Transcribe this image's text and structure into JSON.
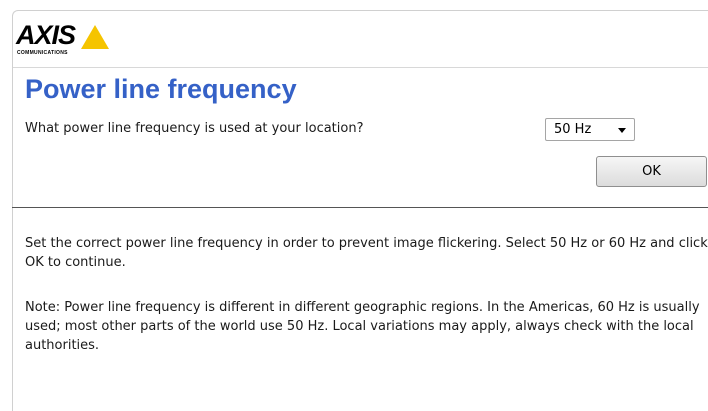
{
  "brand": {
    "logo_text": "AXIS",
    "logo_subtext": "COMMUNICATIONS",
    "triangle_color": "#f5c400"
  },
  "page": {
    "title": "Power line frequency",
    "question": "What power line frequency is used at your location?",
    "frequency_select": {
      "value": "50 Hz",
      "options_visible": [
        "50 Hz"
      ]
    },
    "ok_label": "OK",
    "instructions": "Set the correct power line frequency in order to prevent image flickering. Select 50 Hz or 60 Hz and click OK to continue.",
    "note": "Note: Power line frequency is different in different geographic regions. In the Americas, 60 Hz is usually used; most other parts of the world use 50 Hz. Local variations may apply, always check with the local authorities."
  },
  "colors": {
    "title_blue": "#3561c7",
    "text": "#1a1a1a"
  }
}
